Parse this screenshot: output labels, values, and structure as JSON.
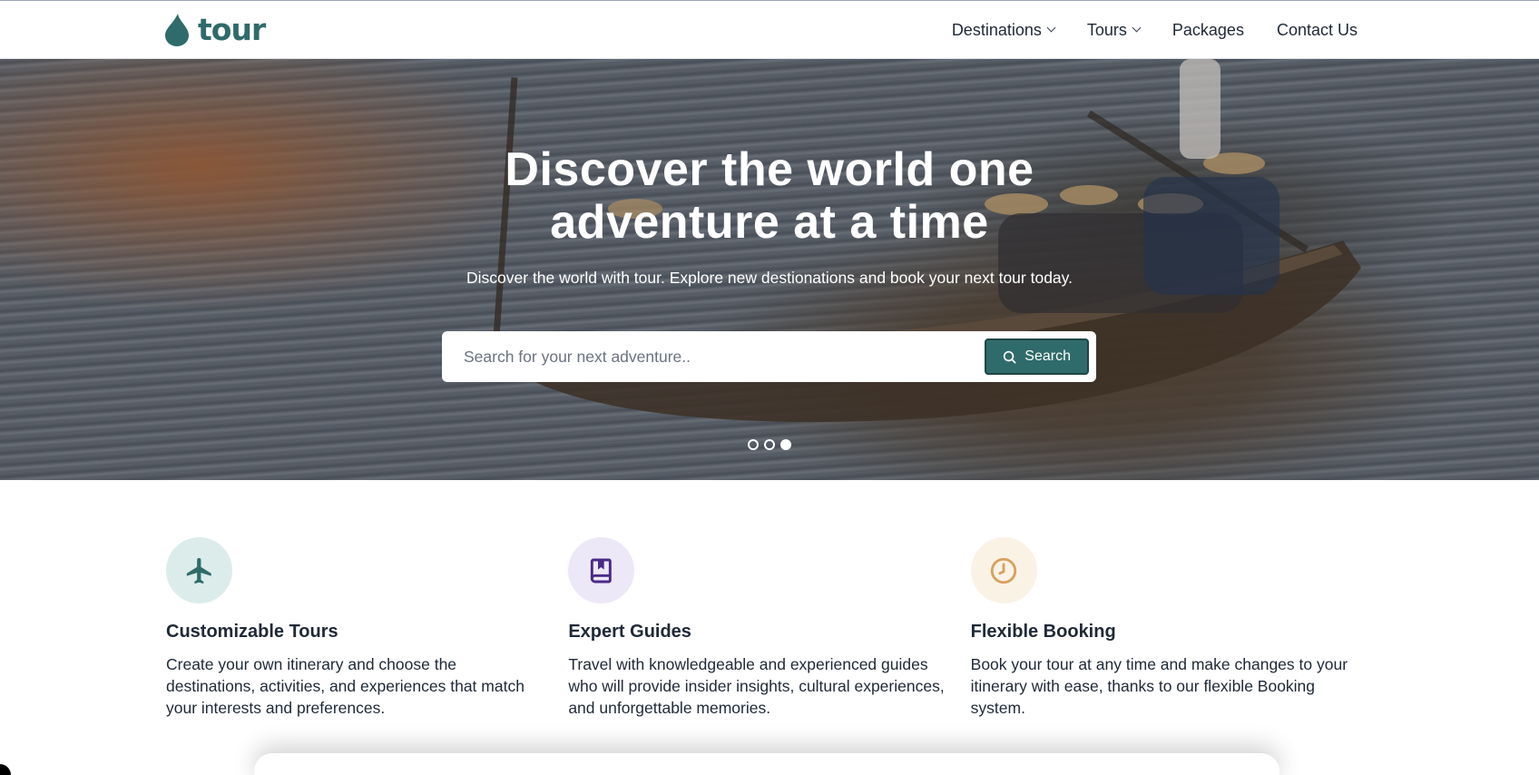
{
  "brand": {
    "name": "tour",
    "color": "#2f6b6a"
  },
  "nav": {
    "items": [
      {
        "label": "Destinations",
        "dropdown": true
      },
      {
        "label": "Tours",
        "dropdown": true
      },
      {
        "label": "Packages",
        "dropdown": false
      },
      {
        "label": "Contact Us",
        "dropdown": false
      }
    ]
  },
  "hero": {
    "title_line1": "Discover the world one",
    "title_line2": "adventure at a time",
    "subtitle": "Discover the world with tour. Explore new destionations and book your next tour today.",
    "search": {
      "placeholder": "Search for your next adventure..",
      "value": "",
      "button_label": "Search",
      "button_icon": "search-icon"
    },
    "carousel": {
      "slides": 3,
      "active_index": 2
    }
  },
  "features": [
    {
      "icon": "airplane-icon",
      "icon_color": "#2f6b6a",
      "icon_bg": "#dcecea",
      "title": "Customizable Tours",
      "description": "Create your own itinerary and choose the destinations, activities, and experiences that match your interests and preferences."
    },
    {
      "icon": "book-icon",
      "icon_color": "#4b2a8a",
      "icon_bg": "#ede8f7",
      "title": "Expert Guides",
      "description": "Travel with knowledgeable and experienced guides who will provide insider insights, cultural experiences, and unforgettable memories."
    },
    {
      "icon": "clock-icon",
      "icon_color": "#d9a05b",
      "icon_bg": "#fbf2e6",
      "title": "Flexible Booking",
      "description": "Book your tour at any time and make changes to your itinerary with ease, thanks to our flexible Booking system."
    }
  ]
}
